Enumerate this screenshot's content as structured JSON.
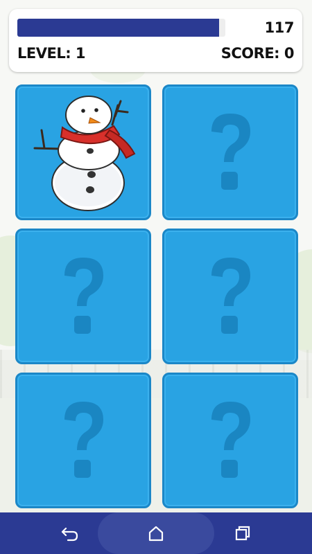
{
  "hud": {
    "timer": "117",
    "level_label": "LEVEL: 1",
    "score_label": "SCORE: 0",
    "progress": 0.97,
    "progress_color": "#2b3a93"
  },
  "board": {
    "rows": 3,
    "cols": 2,
    "cards": [
      {
        "state": "revealed",
        "image": "snowman-icon"
      },
      {
        "state": "hidden",
        "image": "question-mark-icon"
      },
      {
        "state": "hidden",
        "image": "question-mark-icon"
      },
      {
        "state": "hidden",
        "image": "question-mark-icon"
      },
      {
        "state": "hidden",
        "image": "question-mark-icon"
      },
      {
        "state": "hidden",
        "image": "question-mark-icon"
      }
    ],
    "card_color": "#29a3e3"
  },
  "navbar": {
    "buttons": [
      "back-icon",
      "home-icon",
      "recents-icon"
    ]
  }
}
